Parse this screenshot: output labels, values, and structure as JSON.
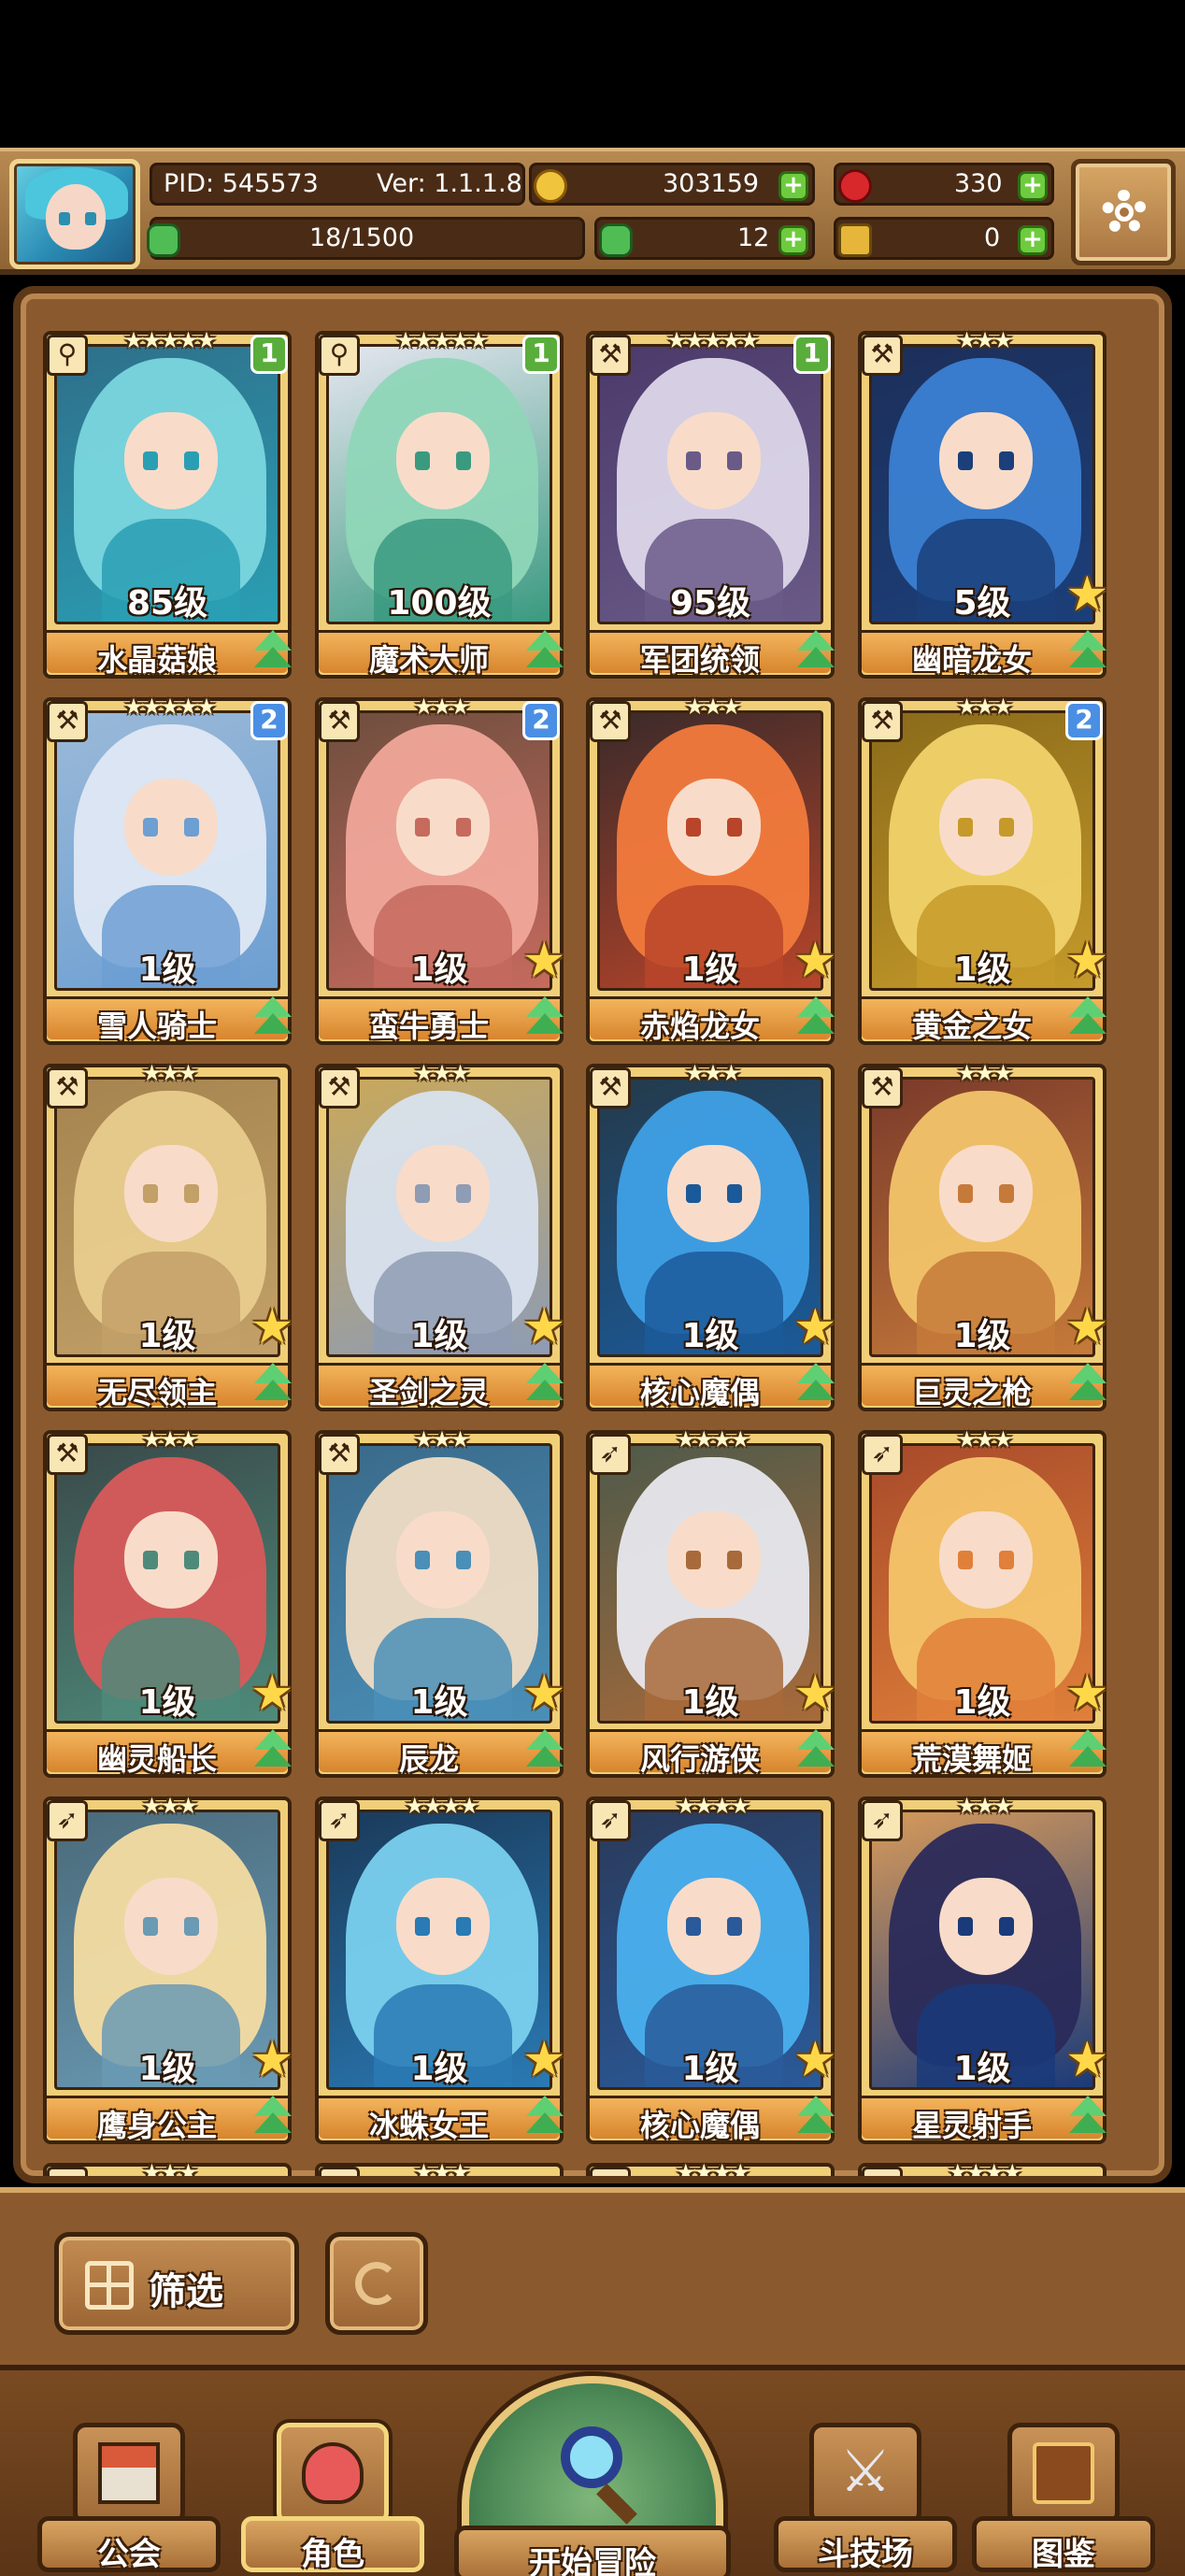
{
  "header": {
    "pid": "PID: 545573",
    "version": "Ver: 1.1.1.8",
    "gold": "303159",
    "gems": "330",
    "exp": "18/1500",
    "clover": "12",
    "keys": "0"
  },
  "colors": {
    "gold_coin": "#f0c43c",
    "gem": "#d8282c",
    "clover": "#4fbd53",
    "key": "#e5b63a",
    "plus_green": "#6ecb3e"
  },
  "cards": [
    {
      "stars": "★★★★★",
      "level": "85级",
      "name": "水晶菇娘",
      "badge": "1",
      "badge_color": "green",
      "upgrade_star": false,
      "class_icon": "sword-class-icon",
      "art": [
        "#7ad6de",
        "#2a9fb4",
        "#2f6f8a"
      ]
    },
    {
      "stars": "★★★★★",
      "level": "100级",
      "name": "魔术大师",
      "badge": "1",
      "badge_color": "green",
      "upgrade_star": false,
      "class_icon": "sword-class-icon",
      "art": [
        "#8fd6b8",
        "#3a9a80",
        "#e6e6f0"
      ]
    },
    {
      "stars": "★★★★★",
      "level": "95级",
      "name": "军团统领",
      "badge": "1",
      "badge_color": "green",
      "upgrade_star": false,
      "class_icon": "axe-class-icon",
      "art": [
        "#ddd7ea",
        "#6a5a88",
        "#4b3a6a"
      ]
    },
    {
      "stars": "★★★",
      "level": "5级",
      "name": "幽暗龙女",
      "badge": "",
      "badge_color": "",
      "upgrade_star": true,
      "class_icon": "axe-class-icon",
      "art": [
        "#3b7fd2",
        "#1b3f7a",
        "#1d2f5a"
      ]
    },
    {
      "stars": "★★★★★",
      "level": "1级",
      "name": "雪人骑士",
      "badge": "2",
      "badge_color": "blue",
      "upgrade_star": false,
      "class_icon": "axe-class-icon",
      "art": [
        "#dfe8f4",
        "#6d9fd2",
        "#9ab9d8"
      ]
    },
    {
      "stars": "★★★",
      "level": "1级",
      "name": "蛮牛勇士",
      "badge": "2",
      "badge_color": "blue",
      "upgrade_star": true,
      "class_icon": "axe-class-icon",
      "art": [
        "#f0a79a",
        "#c66a5e",
        "#6e4e3e"
      ]
    },
    {
      "stars": "★★★",
      "level": "1级",
      "name": "赤焰龙女",
      "badge": "",
      "badge_color": "",
      "upgrade_star": true,
      "class_icon": "axe-class-icon",
      "art": [
        "#f27a3c",
        "#b8452a",
        "#3a2a2a"
      ]
    },
    {
      "stars": "★★★",
      "level": "1级",
      "name": "黄金之女",
      "badge": "2",
      "badge_color": "blue",
      "upgrade_star": true,
      "class_icon": "axe-class-icon",
      "art": [
        "#f0d26a",
        "#c59a2a",
        "#8a6a1a"
      ]
    },
    {
      "stars": "★★★",
      "level": "1级",
      "name": "无尽领主",
      "badge": "",
      "badge_color": "",
      "upgrade_star": true,
      "class_icon": "axe-class-icon",
      "art": [
        "#e8cc8e",
        "#c2a068",
        "#a6844f"
      ]
    },
    {
      "stars": "★★★",
      "level": "1级",
      "name": "圣剑之灵",
      "badge": "",
      "badge_color": "",
      "upgrade_star": true,
      "class_icon": "axe-class-icon",
      "art": [
        "#d8e2ee",
        "#8e9cb4",
        "#c9a85a"
      ]
    },
    {
      "stars": "★★★",
      "level": "1级",
      "name": "核心魔偶",
      "badge": "",
      "badge_color": "",
      "upgrade_star": true,
      "class_icon": "axe-class-icon",
      "art": [
        "#3fa0e6",
        "#1b5a9a",
        "#243a4a"
      ]
    },
    {
      "stars": "★★★",
      "level": "1级",
      "name": "巨灵之枪",
      "badge": "",
      "badge_color": "",
      "upgrade_star": true,
      "class_icon": "axe-class-icon",
      "art": [
        "#f2c46a",
        "#c67a3a",
        "#7a3a2a"
      ]
    },
    {
      "stars": "★★★",
      "level": "1级",
      "name": "幽灵船长",
      "badge": "",
      "badge_color": "",
      "upgrade_star": true,
      "class_icon": "axe-class-icon",
      "art": [
        "#d85a5a",
        "#4e8a7a",
        "#3a4a4a"
      ]
    },
    {
      "stars": "★★★",
      "level": "1级",
      "name": "辰龙",
      "badge": "",
      "badge_color": "",
      "upgrade_star": true,
      "class_icon": "axe-class-icon",
      "art": [
        "#efdcc4",
        "#4a8fb8",
        "#3a6a8a"
      ]
    },
    {
      "stars": "★★★★",
      "level": "1级",
      "name": "风行游侠",
      "badge": "",
      "badge_color": "",
      "upgrade_star": true,
      "class_icon": "bow-class-icon",
      "art": [
        "#e8e8ee",
        "#a86a3a",
        "#4e5a4a"
      ]
    },
    {
      "stars": "★★★",
      "level": "1级",
      "name": "荒漠舞姬",
      "badge": "",
      "badge_color": "",
      "upgrade_star": true,
      "class_icon": "bow-class-icon",
      "art": [
        "#f4c46a",
        "#e0803a",
        "#a84a2a"
      ]
    },
    {
      "stars": "★★★",
      "level": "1级",
      "name": "鹰身公主",
      "badge": "",
      "badge_color": "",
      "upgrade_star": true,
      "class_icon": "bow-class-icon",
      "art": [
        "#f4dca2",
        "#6a9ab4",
        "#4a6a7a"
      ]
    },
    {
      "stars": "★★★★",
      "level": "1级",
      "name": "冰蛛女王",
      "badge": "",
      "badge_color": "",
      "upgrade_star": true,
      "class_icon": "bow-class-icon",
      "art": [
        "#7ad0ee",
        "#2a7ab4",
        "#1a3a5a"
      ]
    },
    {
      "stars": "★★★★",
      "level": "1级",
      "name": "核心魔偶",
      "badge": "",
      "badge_color": "",
      "upgrade_star": true,
      "class_icon": "bow-class-icon",
      "art": [
        "#4ab0ee",
        "#2a5a9a",
        "#2a3a5a"
      ]
    },
    {
      "stars": "★★★",
      "level": "1级",
      "name": "星灵射手",
      "badge": "",
      "badge_color": "",
      "upgrade_star": true,
      "class_icon": "bow-class-icon",
      "art": [
        "#2a2a5a",
        "#1a3a7a",
        "#d89a5a"
      ]
    }
  ],
  "partial_row": [
    {
      "stars": "★★★",
      "art": [
        "#4a4a7a",
        "#2a2a4a",
        "#3a3a5a"
      ]
    },
    {
      "stars": "★★★",
      "art": [
        "#4a3a4a",
        "#3a2a3a",
        "#5a4a5a"
      ]
    },
    {
      "stars": "★★★★",
      "art": [
        "#e8a08a",
        "#c47060",
        "#a05a4a"
      ]
    },
    {
      "stars": "★★★★",
      "art": [
        "#f0c8c8",
        "#d49090",
        "#b87070"
      ]
    }
  ],
  "filter": {
    "label": "筛选"
  },
  "nav": [
    {
      "label": "公会",
      "icon": "guild-house-icon",
      "active": false
    },
    {
      "label": "角色",
      "icon": "character-icon",
      "active": true
    },
    {
      "label": "开始冒险",
      "icon": "adventure-magnifier-icon",
      "active": false
    },
    {
      "label": "斗技场",
      "icon": "crossed-swords-icon",
      "active": false
    },
    {
      "label": "图鉴",
      "icon": "codex-book-icon",
      "active": false
    }
  ]
}
